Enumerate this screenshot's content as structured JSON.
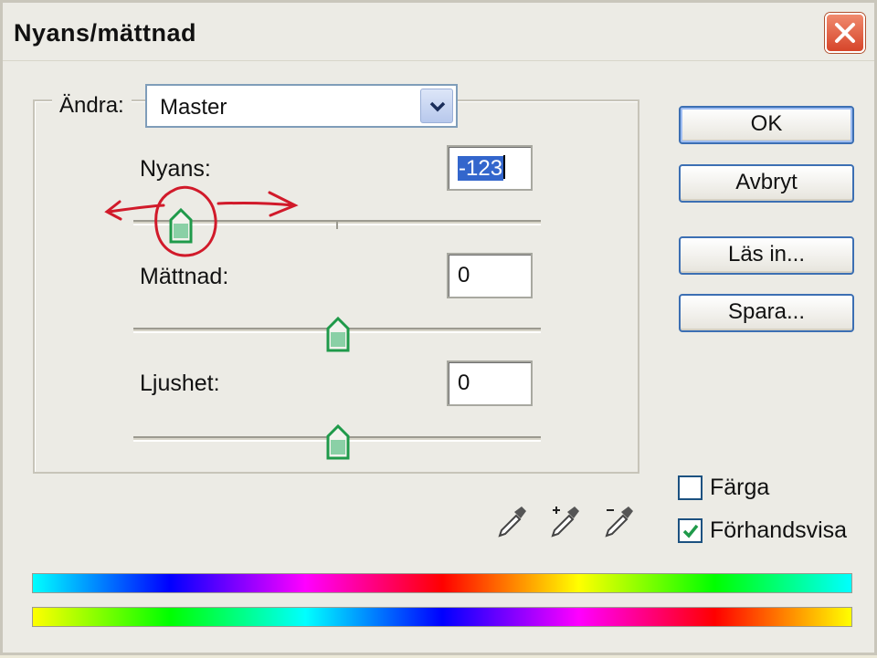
{
  "window": {
    "title": "Nyans/mättnad",
    "close_icon": "close-icon"
  },
  "edit": {
    "label": "Ändra:",
    "selected": "Master"
  },
  "sliders": {
    "hue": {
      "label": "Nyans:",
      "value": "-123",
      "min": -180,
      "max": 180
    },
    "saturation": {
      "label": "Mättnad:",
      "value": "0",
      "min": -100,
      "max": 100
    },
    "lightness": {
      "label": "Ljushet:",
      "value": "0",
      "min": -100,
      "max": 100
    }
  },
  "buttons": {
    "ok": "OK",
    "cancel": "Avbryt",
    "load": "Läs in...",
    "save": "Spara..."
  },
  "checkboxes": {
    "colorize": {
      "label": "Färga",
      "checked": false
    },
    "preview": {
      "label": "Förhandsvisa",
      "checked": true
    }
  },
  "icons": [
    "eyedropper-icon",
    "eyedropper-plus-icon",
    "eyedropper-minus-icon"
  ],
  "colors": {
    "annotation": "#d11a2a",
    "thumb": "#1f9a4a",
    "button_border": "#3c6fb3",
    "close_button": "#d6452a"
  }
}
